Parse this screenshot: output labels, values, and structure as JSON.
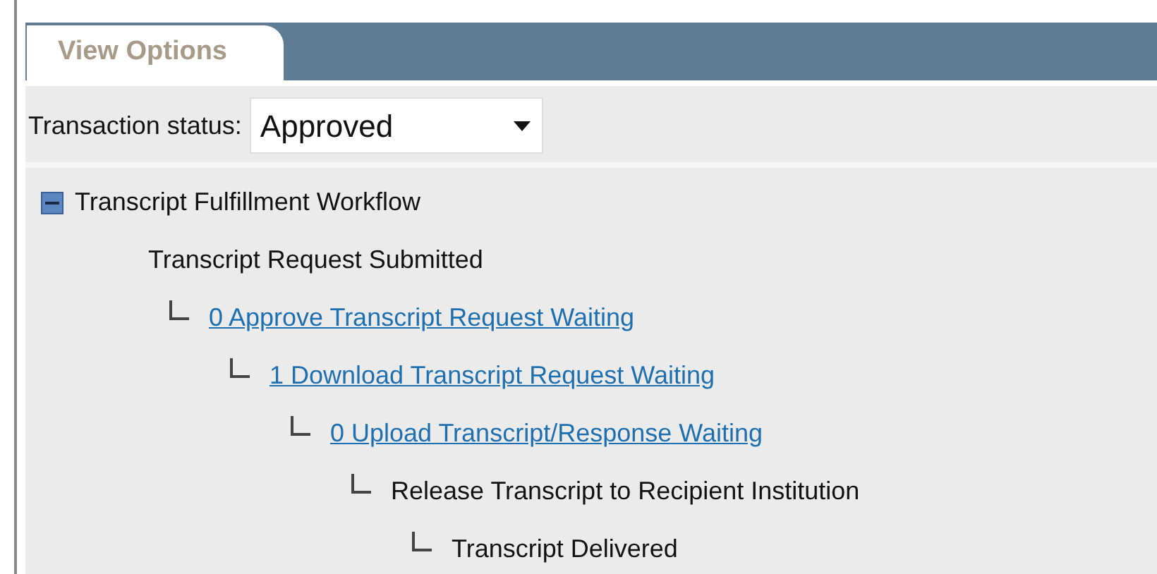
{
  "tabs": [
    {
      "label": "View Options",
      "selected": true
    }
  ],
  "status_filter": {
    "label": "Transaction status:",
    "value": "Approved"
  },
  "tree": {
    "label": "Transcript Fulfillment Workflow",
    "expanded": true,
    "children": [
      {
        "label": "Transcript Request Submitted",
        "kind": "text",
        "children": [
          {
            "label": "0 Approve Transcript Request Waiting",
            "kind": "link",
            "children": [
              {
                "label": "1 Download Transcript Request Waiting",
                "kind": "link",
                "children": [
                  {
                    "label": "0 Upload Transcript/Response Waiting",
                    "kind": "link",
                    "children": [
                      {
                        "label": "Release Transcript to Recipient Institution",
                        "kind": "text",
                        "children": [
                          {
                            "label": "Transcript Delivered",
                            "kind": "text"
                          }
                        ]
                      }
                    ]
                  }
                ]
              }
            ]
          }
        ]
      }
    ]
  }
}
